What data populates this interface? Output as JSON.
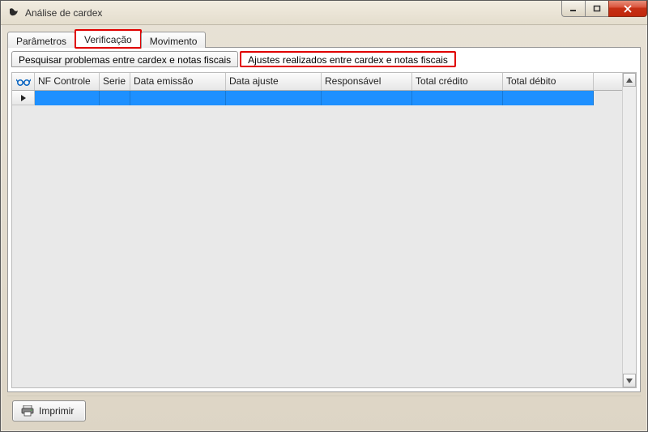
{
  "window": {
    "title": "Análise de cardex"
  },
  "tabs": {
    "parametros": "Parâmetros",
    "verificacao": "Verificação",
    "movimento": "Movimento"
  },
  "sub_tabs": {
    "pesquisar": "Pesquisar problemas entre cardex e notas fiscais",
    "ajustes": "Ajustes realizados entre cardex e notas fiscais"
  },
  "grid": {
    "headers": {
      "nf_controle": "NF Controle",
      "serie": "Serie",
      "data_emissao": "Data emissão",
      "data_ajuste": "Data ajuste",
      "responsavel": "Responsável",
      "total_credito": "Total crédito",
      "total_debito": "Total débito"
    },
    "rows": [
      {
        "nf_controle": "",
        "serie": "",
        "data_emissao": "",
        "data_ajuste": "",
        "responsavel": "",
        "total_credito": "",
        "total_debito": ""
      }
    ]
  },
  "buttons": {
    "imprimir": "Imprimir"
  },
  "icons": {
    "glasses": "glasses-icon",
    "printer": "printer-icon"
  }
}
